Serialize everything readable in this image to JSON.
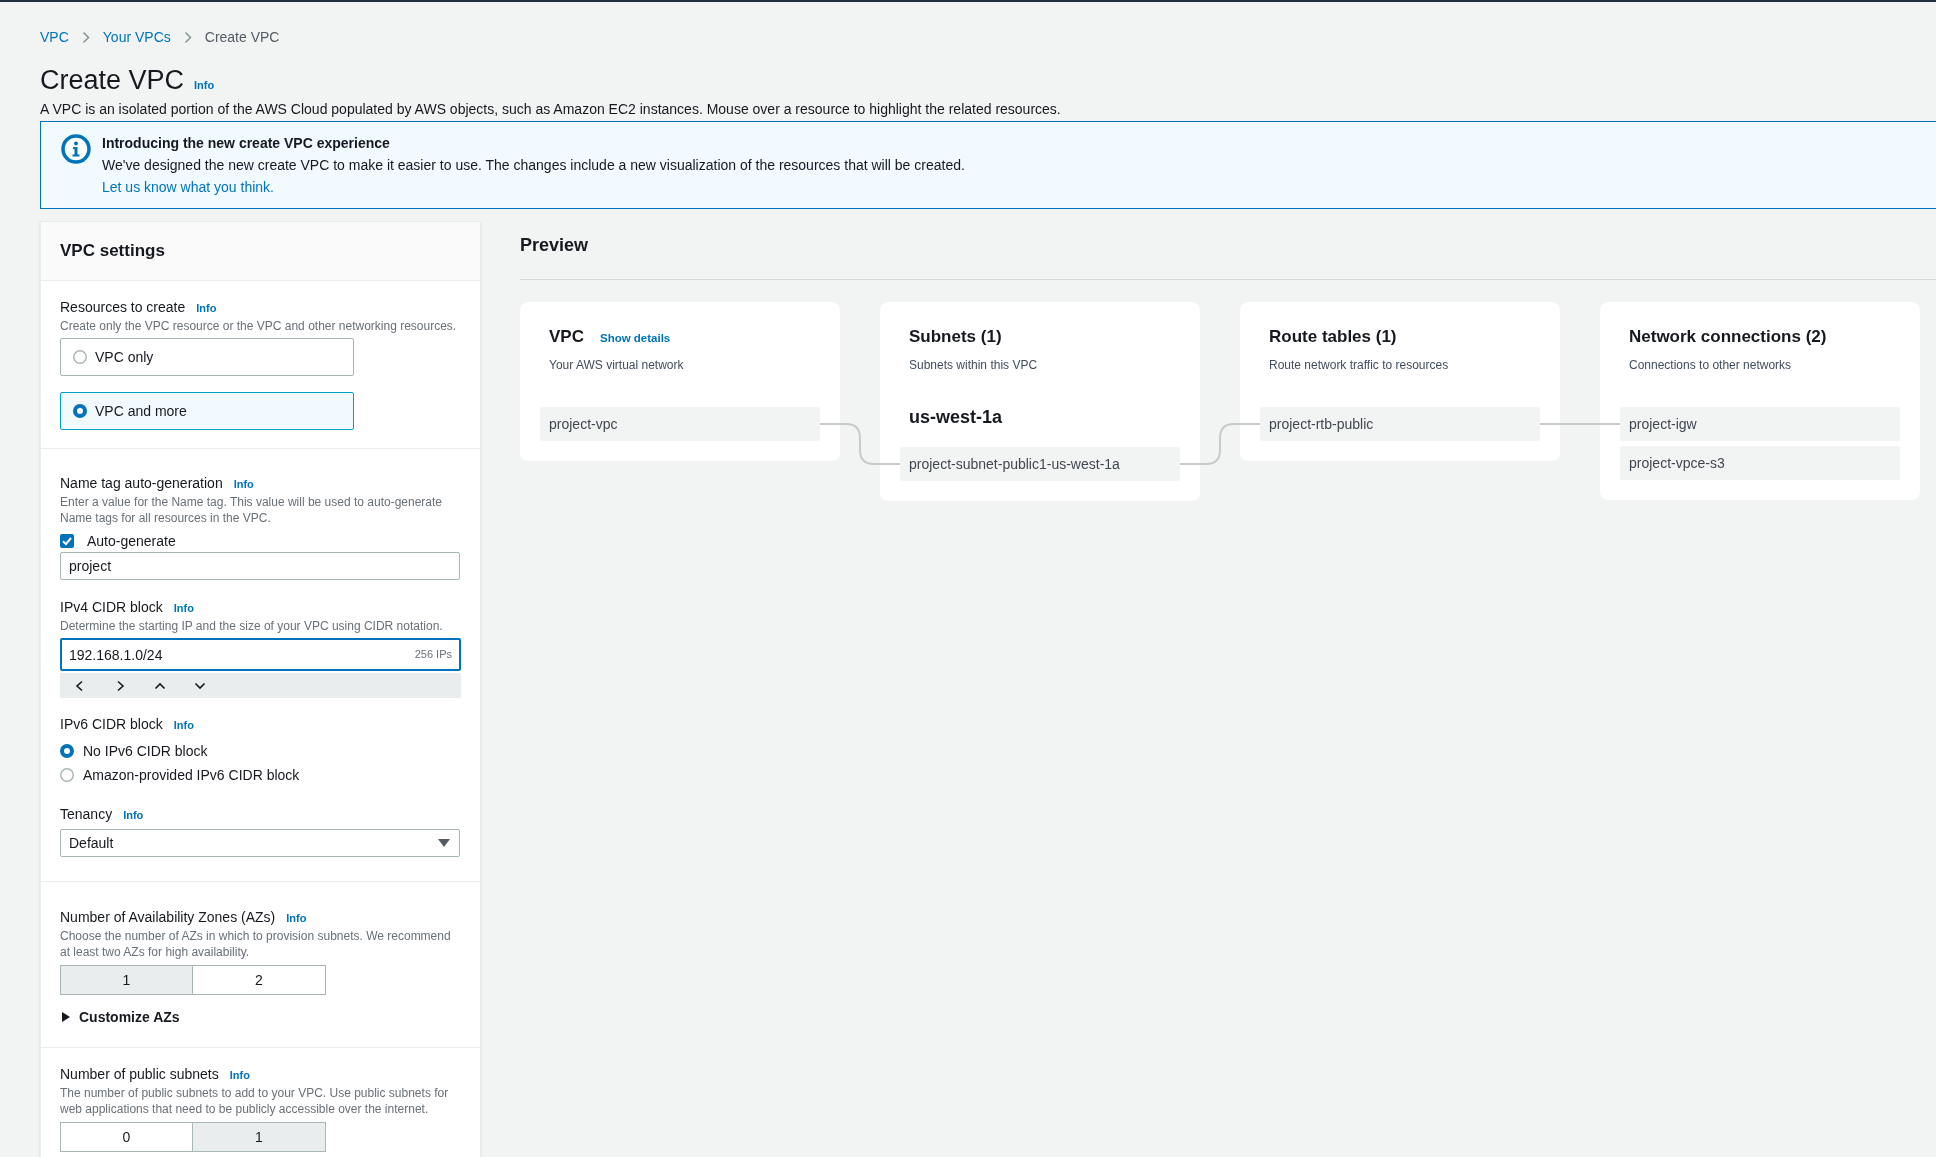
{
  "breadcrumb": [
    {
      "label": "VPC",
      "current": false
    },
    {
      "label": "Your VPCs",
      "current": false
    },
    {
      "label": "Create VPC",
      "current": true
    }
  ],
  "header": {
    "title": "Create VPC",
    "info": "Info",
    "description": "A VPC is an isolated portion of the AWS Cloud populated by AWS objects, such as Amazon EC2 instances. Mouse over a resource to highlight the related resources."
  },
  "alert": {
    "title": "Introducing the new create VPC experience",
    "message": "We've designed the new create VPC to make it easier to use. The changes include a new visualization of the resources that will be created.",
    "link": "Let us know what you think."
  },
  "settings": {
    "title": "VPC settings",
    "sections": [
      {
        "fields": [
          {
            "kind": "tiles",
            "label": "Resources to create",
            "info": "Info",
            "description": "Create only the VPC resource or the VPC and other networking resources.",
            "options": [
              {
                "label": "VPC only",
                "selected": false
              },
              {
                "label": "VPC and more",
                "selected": true
              }
            ]
          }
        ]
      },
      {
        "fields": [
          {
            "kind": "nametag",
            "label": "Name tag auto-generation",
            "info": "Info",
            "description": "Enter a value for the Name tag. This value will be used to auto-generate Name tags for all resources in the VPC.",
            "checkbox": {
              "label": "Auto-generate",
              "checked": true
            },
            "value": "project"
          },
          {
            "kind": "cidr",
            "label": "IPv4 CIDR block",
            "info": "Info",
            "description": "Determine the starting IP and the size of your VPC using CIDR notation.",
            "value": "192.168.1.0/24",
            "ip_count": "256 IPs",
            "focused": true
          },
          {
            "kind": "radios",
            "label": "IPv6 CIDR block",
            "info": "Info",
            "options": [
              {
                "label": "No IPv6 CIDR block",
                "selected": true
              },
              {
                "label": "Amazon-provided IPv6 CIDR block",
                "selected": false
              }
            ]
          },
          {
            "kind": "select",
            "label": "Tenancy",
            "info": "Info",
            "value": "Default"
          }
        ]
      },
      {
        "fields": [
          {
            "kind": "segmented",
            "label": "Number of Availability Zones (AZs)",
            "info": "Info",
            "description": "Choose the number of AZs in which to provision subnets. We recommend at least two AZs for high availability.",
            "options": [
              {
                "label": "1",
                "selected": true
              },
              {
                "label": "2",
                "selected": false
              }
            ]
          },
          {
            "kind": "expander",
            "label": "Customize AZs",
            "expanded": false
          }
        ]
      },
      {
        "fields": [
          {
            "kind": "segmented",
            "label": "Number of public subnets",
            "info": "Info",
            "description": "The number of public subnets to add to your VPC. Use public subnets for web applications that need to be publicly accessible over the internet.",
            "options": [
              {
                "label": "0",
                "selected": false
              },
              {
                "label": "1",
                "selected": true
              }
            ]
          }
        ]
      }
    ]
  },
  "preview": {
    "title": "Preview",
    "cards": [
      {
        "title": "VPC",
        "link": "Show details",
        "subtitle": "Your AWS virtual network",
        "items": [
          "project-vpc"
        ]
      },
      {
        "title": "Subnets (1)",
        "subtitle": "Subnets within this VPC",
        "zones": [
          {
            "name": "us-west-1a",
            "items": [
              "project-subnet-public1-us-west-1a"
            ]
          }
        ]
      },
      {
        "title": "Route tables (1)",
        "subtitle": "Route network traffic to resources",
        "items": [
          "project-rtb-public"
        ]
      },
      {
        "title": "Network connections (2)",
        "subtitle": "Connections to other networks",
        "items": [
          "project-igw",
          "project-vpce-s3"
        ]
      }
    ]
  }
}
